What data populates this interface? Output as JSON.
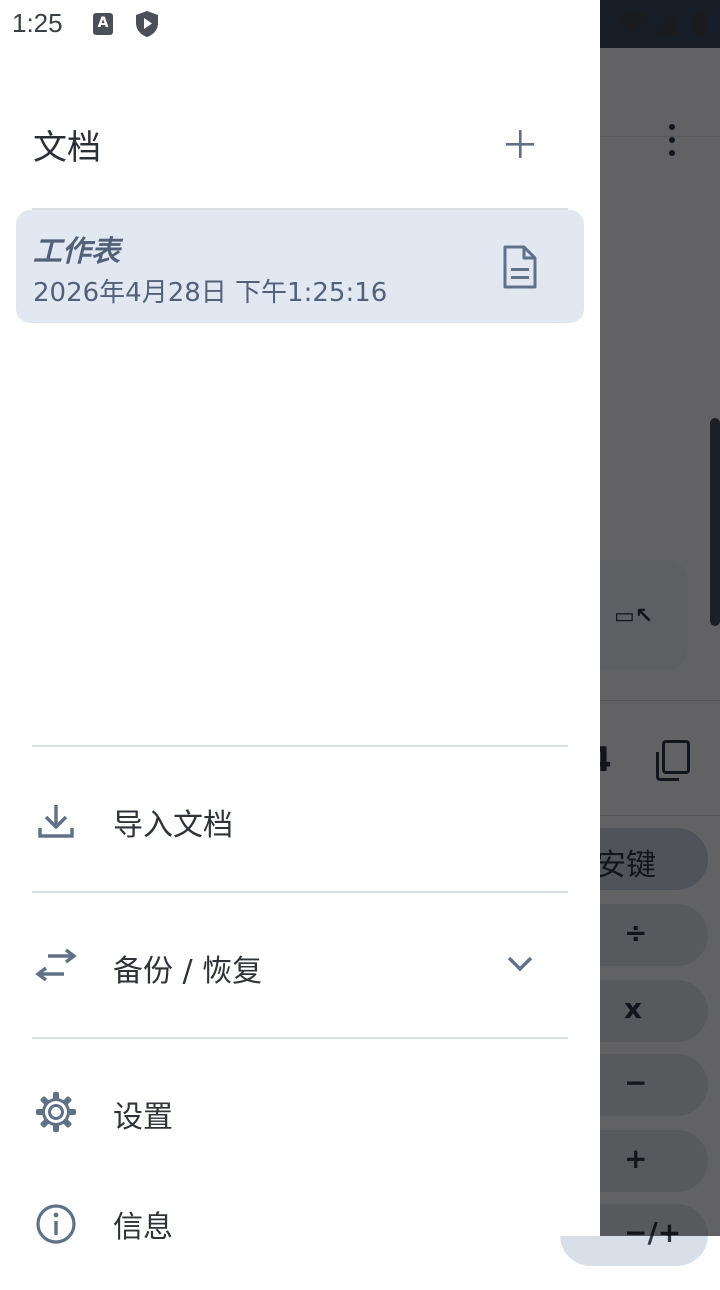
{
  "status_bar": {
    "time": "1:25",
    "notification_a": "A"
  },
  "background": {
    "result_digit": "4",
    "keys": [
      "安键",
      "÷",
      "x",
      "−",
      "+",
      "−/+"
    ]
  },
  "drawer": {
    "title": "文档",
    "document": {
      "name": "工作表",
      "date": "2026年4月28日 下午1:25:16"
    },
    "menu": {
      "import": "导入文档",
      "backup": "备份 / 恢复",
      "settings": "设置",
      "info": "信息"
    }
  },
  "colors": {
    "accent": "#607086",
    "card_bg": "#e2e8f1",
    "text_muted": "#536178"
  }
}
